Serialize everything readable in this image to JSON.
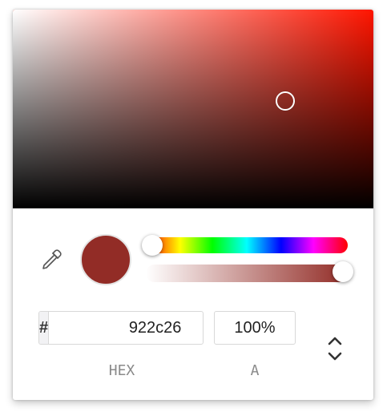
{
  "color": {
    "hex": "922c26",
    "swatch_color": "#922c26",
    "hue_color": "#ff1500",
    "hue_position": 0.01,
    "alpha_position": 1.0,
    "saturation": 0.74,
    "value": 0.57
  },
  "hex_field": {
    "prefix": "#",
    "value": "922c26",
    "label": "HEX"
  },
  "alpha_field": {
    "value": "100%",
    "label": "A"
  },
  "icons": {
    "eyedropper": "eyedropper-icon",
    "toggle": "chevron-up-down-icon"
  }
}
